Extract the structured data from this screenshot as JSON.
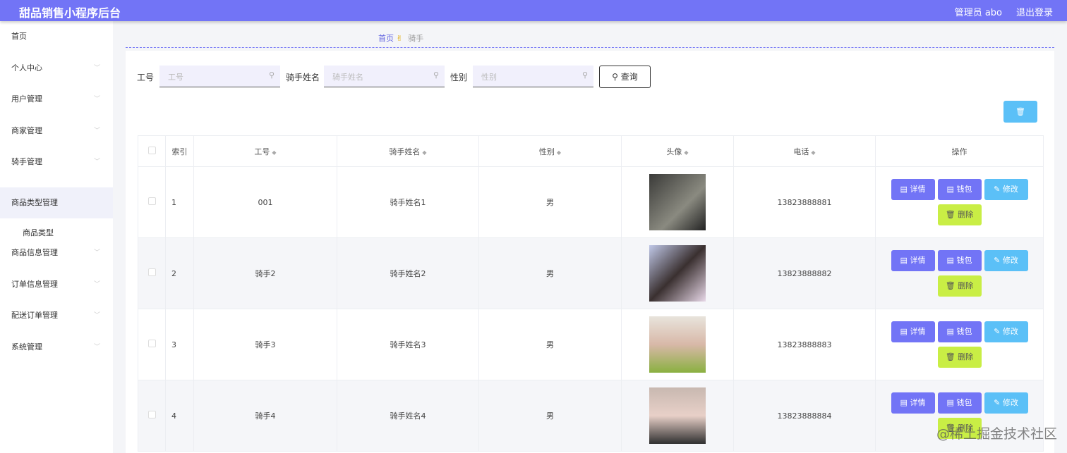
{
  "header": {
    "title": "甜品销售小程序后台",
    "user": "管理员 abo",
    "logout": "退出登录"
  },
  "sidebar": {
    "items": [
      {
        "label": "首页"
      },
      {
        "label": "个人中心"
      },
      {
        "label": "用户管理"
      },
      {
        "label": "商家管理"
      },
      {
        "label": "骑手管理"
      },
      {
        "label": "商品类型管理"
      },
      {
        "label": "商品信息管理"
      },
      {
        "label": "订单信息管理"
      },
      {
        "label": "配送订单管理"
      },
      {
        "label": "系统管理"
      }
    ],
    "sub_item": "商品类型"
  },
  "breadcrumb": {
    "home": "首页",
    "current": "骑手"
  },
  "filters": {
    "id_label": "工号",
    "id_placeholder": "工号",
    "name_label": "骑手姓名",
    "name_placeholder": "骑手姓名",
    "gender_label": "性别",
    "gender_placeholder": "性别",
    "query": "查询"
  },
  "table": {
    "headers": [
      "索引",
      "工号",
      "骑手姓名",
      "性别",
      "头像",
      "电话",
      "操作"
    ],
    "rows": [
      {
        "index": "1",
        "id": "001",
        "name": "骑手姓名1",
        "gender": "男",
        "phone": "13823888881"
      },
      {
        "index": "2",
        "id": "骑手2",
        "name": "骑手姓名2",
        "gender": "男",
        "phone": "13823888882"
      },
      {
        "index": "3",
        "id": "骑手3",
        "name": "骑手姓名3",
        "gender": "男",
        "phone": "13823888883"
      },
      {
        "index": "4",
        "id": "骑手4",
        "name": "骑手姓名4",
        "gender": "男",
        "phone": "13823888884"
      }
    ],
    "actions": {
      "detail": "详情",
      "wallet": "钱包",
      "edit": "修改",
      "delete": "删除"
    }
  },
  "watermark": "@稀土掘金技术社区"
}
